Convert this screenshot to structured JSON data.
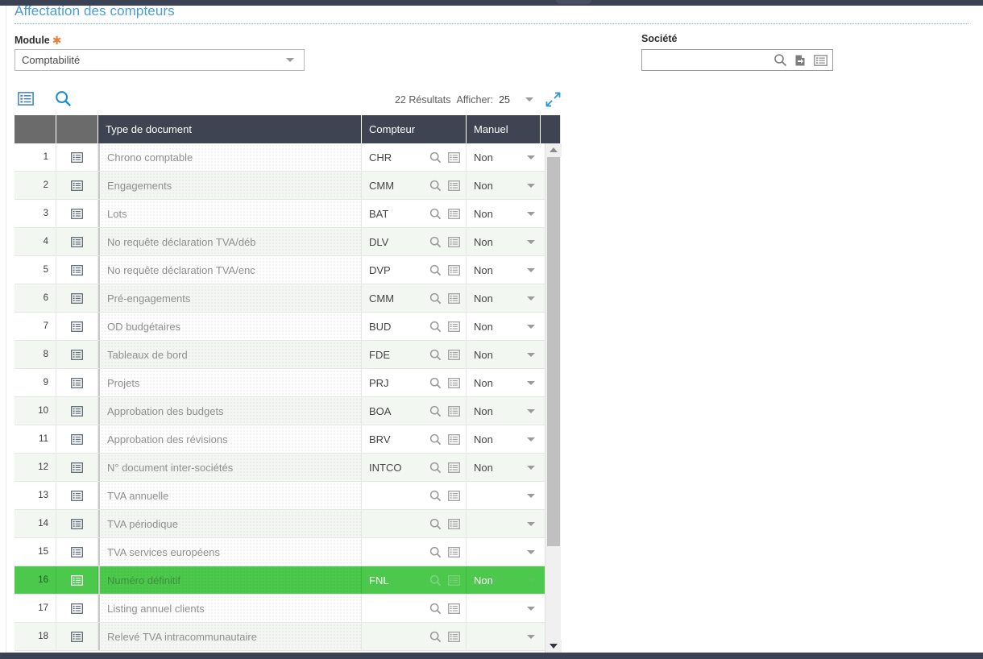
{
  "page": {
    "title": "Affectation des compteurs"
  },
  "form": {
    "module": {
      "label": "Module",
      "required_mark": "✱",
      "value": "Comptabilité"
    },
    "societe": {
      "label": "Société",
      "value": "",
      "placeholder": "",
      "icons": [
        "search-icon",
        "open-record-icon",
        "detail-list-icon"
      ]
    }
  },
  "toolbar": {
    "list_icon": "detail-list-icon",
    "search_icon": "search-icon",
    "results_text": "22 Résultats",
    "afficher_label": "Afficher:",
    "page_size": "25",
    "expand_icon": "expand-diagonal-icon"
  },
  "table": {
    "columns": [
      {
        "key": "num",
        "label": ""
      },
      {
        "key": "rowicon",
        "label": ""
      },
      {
        "key": "type",
        "label": "Type de document"
      },
      {
        "key": "compteur",
        "label": "Compteur"
      },
      {
        "key": "manuel",
        "label": "Manuel"
      },
      {
        "key": "tail",
        "label": ""
      }
    ],
    "cell_icons": [
      "search-icon",
      "detail-list-icon"
    ],
    "row_icon": "detail-list-icon",
    "selected_row_index": 15,
    "selected_color": "#4cc84c",
    "rows": [
      {
        "num": "1",
        "type": "Chrono comptable",
        "compteur": "CHR",
        "manuel": "Non"
      },
      {
        "num": "2",
        "type": "Engagements",
        "compteur": "CMM",
        "manuel": "Non"
      },
      {
        "num": "3",
        "type": "Lots",
        "compteur": "BAT",
        "manuel": "Non"
      },
      {
        "num": "4",
        "type": "No requête déclaration TVA/déb",
        "compteur": "DLV",
        "manuel": "Non"
      },
      {
        "num": "5",
        "type": "No requête déclaration TVA/enc",
        "compteur": "DVP",
        "manuel": "Non"
      },
      {
        "num": "6",
        "type": "Pré-engagements",
        "compteur": "CMM",
        "manuel": "Non"
      },
      {
        "num": "7",
        "type": "OD budgétaires",
        "compteur": "BUD",
        "manuel": "Non"
      },
      {
        "num": "8",
        "type": "Tableaux de bord",
        "compteur": "FDE",
        "manuel": "Non"
      },
      {
        "num": "9",
        "type": "Projets",
        "compteur": "PRJ",
        "manuel": "Non"
      },
      {
        "num": "10",
        "type": "Approbation des budgets",
        "compteur": "BOA",
        "manuel": "Non"
      },
      {
        "num": "11",
        "type": "Approbation des révisions",
        "compteur": "BRV",
        "manuel": "Non"
      },
      {
        "num": "12",
        "type": "N° document inter-sociétés",
        "compteur": "INTCO",
        "manuel": "Non"
      },
      {
        "num": "13",
        "type": "TVA annuelle",
        "compteur": "",
        "manuel": ""
      },
      {
        "num": "14",
        "type": "TVA périodique",
        "compteur": "",
        "manuel": ""
      },
      {
        "num": "15",
        "type": "TVA services européens",
        "compteur": "",
        "manuel": ""
      },
      {
        "num": "16",
        "type": "Numéro définitif",
        "compteur": "FNL",
        "manuel": "Non"
      },
      {
        "num": "17",
        "type": "Listing annuel clients",
        "compteur": "",
        "manuel": ""
      },
      {
        "num": "18",
        "type": "Relevé TVA intracommunautaire",
        "compteur": "",
        "manuel": ""
      }
    ]
  },
  "colors": {
    "accent_blue": "#4a9dd0",
    "header_dark": "#3e4452",
    "header_gray": "#6b6b6b",
    "selected_green": "#4cc84c",
    "required_orange": "#ef7e38"
  }
}
